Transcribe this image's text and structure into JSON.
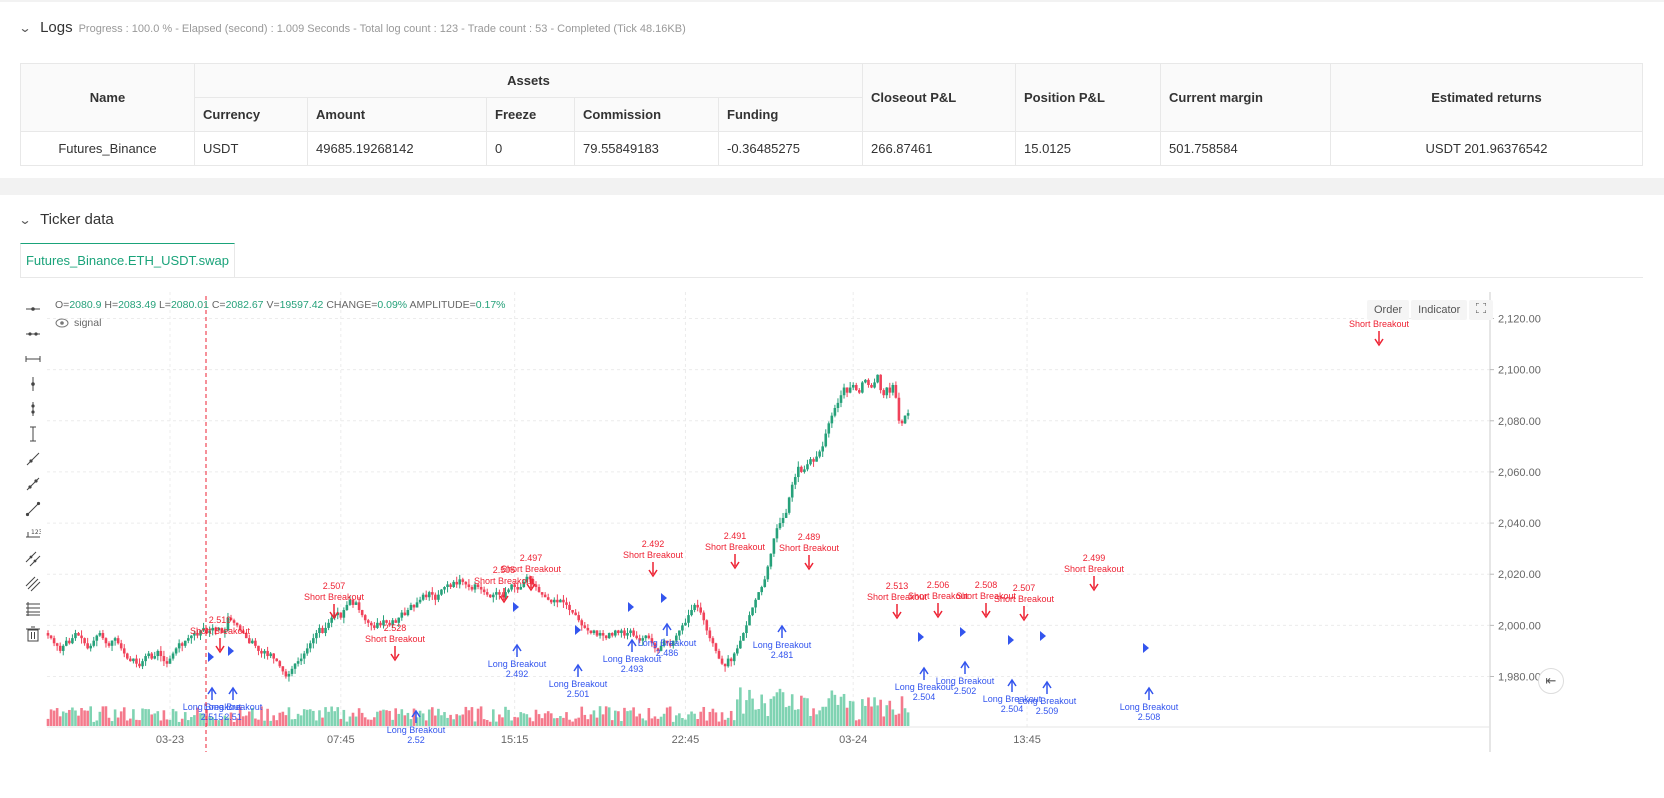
{
  "logs": {
    "title": "Logs",
    "info": "Progress : 100.0 % - Elapsed (second) : 1.009  Seconds - Total log count : 123 - Trade count : 53 - Completed (Tick 48.16KB)"
  },
  "assets_table": {
    "group_header": "Assets",
    "headers": {
      "name": "Name",
      "currency": "Currency",
      "amount": "Amount",
      "freeze": "Freeze",
      "commission": "Commission",
      "funding": "Funding",
      "closeout": "Closeout P&L",
      "position": "Position P&L",
      "margin": "Current margin",
      "returns": "Estimated returns"
    },
    "row": {
      "name": "Futures_Binance",
      "currency": "USDT",
      "amount": "49685.19268142",
      "freeze": "0",
      "commission": "79.55849183",
      "funding": "-0.36485275",
      "closeout": "266.87461",
      "position": "15.0125",
      "margin": "501.758584",
      "returns": "USDT 201.96376542"
    }
  },
  "ticker": {
    "title": "Ticker data",
    "tab": "Futures_Binance.ETH_USDT.swap"
  },
  "ohlc": {
    "o_label": "O=",
    "o": "2080.9",
    "h_label": "H=",
    "h": "2083.49",
    "l_label": "L=",
    "l": "2080.01",
    "c_label": "C=",
    "c": "2082.67",
    "v_label": "V=",
    "v": "19597.42",
    "change_label": "CHANGE=",
    "change": "0.09%",
    "amp_label": "AMPLITUDE=",
    "amp": "0.17%"
  },
  "indicator_legend": "signal",
  "chart_buttons": {
    "order": "Order",
    "indicator": "Indicator"
  },
  "colors": {
    "up": "#26a17a",
    "down": "#f0425a",
    "long": "#3355ee",
    "short": "#ee2233",
    "vol_up": "#7fd3b2",
    "vol_down": "#f47a8c"
  },
  "chart_data": {
    "type": "candlestick",
    "symbol": "ETH_USDT.swap",
    "y_ticks": [
      1980,
      2000,
      2020,
      2040,
      2060,
      2080,
      2100,
      2120
    ],
    "y_tick_labels": [
      "1,980.00",
      "2,000.00",
      "2,020.00",
      "2,040.00",
      "2,060.00",
      "2,080.00",
      "2,100.00",
      "2,120.00"
    ],
    "ylim": [
      1965,
      2127
    ],
    "x_tick_labels": [
      "03-23",
      "07:45",
      "15:15",
      "22:45",
      "03-24",
      "13:45"
    ],
    "x_tick_bar_index": [
      40,
      96,
      153,
      209,
      264,
      321
    ],
    "closes": [
      1996,
      1995,
      1993,
      1992,
      1990,
      1992,
      1994,
      1993,
      1995,
      1997,
      1996,
      1995,
      1993,
      1991,
      1992,
      1994,
      1996,
      1997,
      1995,
      1993,
      1992,
      1994,
      1995,
      1993,
      1991,
      1989,
      1987,
      1986,
      1987,
      1985,
      1984,
      1986,
      1988,
      1989,
      1987,
      1988,
      1990,
      1988,
      1986,
      1985,
      1987,
      1989,
      1991,
      1993,
      1992,
      1994,
      1995,
      1996,
      1997,
      1996,
      1998,
      1999,
      1997,
      1998,
      1999,
      1998,
      1999,
      1997,
      1998,
      2003,
      2002,
      2001,
      2000,
      1998,
      1997,
      1995,
      1993,
      1994,
      1992,
      1990,
      1989,
      1990,
      1988,
      1989,
      1987,
      1986,
      1984,
      1982,
      1980,
      1981,
      1983,
      1985,
      1986,
      1987,
      1989,
      1991,
      1993,
      1995,
      1997,
      1999,
      1997,
      1999,
      2001,
      2003,
      2004,
      2005,
      2003,
      2006,
      2008,
      2010,
      2008,
      2009,
      2006,
      2004,
      2002,
      2001,
      2000,
      1999,
      2001,
      2000,
      2002,
      2001,
      2000,
      2002,
      2001,
      2003,
      2005,
      2004,
      2006,
      2008,
      2007,
      2009,
      2010,
      2012,
      2011,
      2013,
      2012,
      2010,
      2012,
      2014,
      2015,
      2016,
      2015,
      2017,
      2016,
      2018,
      2017,
      2016,
      2015,
      2014,
      2016,
      2015,
      2014,
      2013,
      2012,
      2011,
      2012,
      2013,
      2012,
      2011,
      2013,
      2014,
      2016,
      2015,
      2014,
      2015,
      2017,
      2019,
      2018,
      2016,
      2015,
      2013,
      2012,
      2011,
      2010,
      2009,
      2010,
      2009,
      2010,
      2009,
      2008,
      2006,
      2005,
      2004,
      2002,
      2000,
      1999,
      1998,
      1997,
      1998,
      1996,
      1997,
      1996,
      1995,
      1997,
      1996,
      1998,
      1997,
      1998,
      1996,
      1997,
      1998,
      1996,
      1995,
      1994,
      1995,
      1996,
      1995,
      1993,
      1991,
      1990,
      1992,
      1994,
      1993,
      1992,
      1994,
      1996,
      1998,
      2000,
      2001,
      2004,
      2006,
      2008,
      2007,
      2005,
      2002,
      1998,
      1995,
      1993,
      1990,
      1987,
      1985,
      1984,
      1987,
      1986,
      1989,
      1991,
      1994,
      1997,
      2000,
      2004,
      2007,
      2010,
      2013,
      2015,
      2018,
      2023,
      2028,
      2034,
      2038,
      2040,
      2042,
      2044,
      2050,
      2055,
      2058,
      2062,
      2060,
      2061,
      2063,
      2065,
      2064,
      2066,
      2068,
      2070,
      2075,
      2079,
      2082,
      2085,
      2087,
      2090,
      2093,
      2091,
      2093,
      2094,
      2092,
      2091,
      2095,
      2096,
      2094,
      2093,
      2095,
      2098,
      2092,
      2090,
      2093,
      2091,
      2094,
      2089,
      2080,
      2079,
      2082,
      2083
    ]
  },
  "signals": [
    {
      "type": "short",
      "label": "Short Breakout",
      "value": "2.519"
    },
    {
      "type": "long",
      "label": "Long Breakout",
      "value": "2.515"
    },
    {
      "type": "long",
      "label": "Long Breakout",
      "value": "2.51"
    },
    {
      "type": "short",
      "label": "Short Breakout",
      "value": "2.507"
    },
    {
      "type": "short",
      "label": "Short Breakout",
      "value": "2.528"
    },
    {
      "type": "long",
      "label": "Long Breakout",
      "value": "2.52"
    },
    {
      "type": "short",
      "label": "Short Breakout",
      "value": "2.505"
    },
    {
      "type": "short",
      "label": "Short Breakout",
      "value": "2.497"
    },
    {
      "type": "long",
      "label": "Long Breakout",
      "value": "2.492"
    },
    {
      "type": "long",
      "label": "Long Breakout",
      "value": "2.501"
    },
    {
      "type": "short",
      "label": "Short Breakout",
      "value": "2.492"
    },
    {
      "type": "long",
      "label": "Long Breakout",
      "value": "2.493"
    },
    {
      "type": "long",
      "label": "Long Breakout",
      "value": "2.486"
    },
    {
      "type": "short",
      "label": "Short Breakout",
      "value": "2.491"
    },
    {
      "type": "long",
      "label": "Long Breakout",
      "value": "2.481"
    },
    {
      "type": "short",
      "label": "Short Breakout",
      "value": "2.489"
    },
    {
      "type": "short",
      "label": "Short Breakout",
      "value": "2.513"
    },
    {
      "type": "short",
      "label": "Short Breakout",
      "value": "2.506"
    },
    {
      "type": "long",
      "label": "Long Breakout",
      "value": "2.504"
    },
    {
      "type": "long",
      "label": "Long Breakout",
      "value": "2.502"
    },
    {
      "type": "short",
      "label": "Short Breakout",
      "value": "2.508"
    },
    {
      "type": "short",
      "label": "Short Breakout",
      "value": "2.507"
    },
    {
      "type": "long",
      "label": "Long Breakout",
      "value": "2.504"
    },
    {
      "type": "long",
      "label": "Long Breakout",
      "value": "2.509"
    },
    {
      "type": "short",
      "label": "Short Breakout",
      "value": "2.499"
    },
    {
      "type": "long",
      "label": "Long Breakout",
      "value": "2.508"
    },
    {
      "type": "short",
      "label": "Short Breakout",
      "value": ""
    }
  ]
}
